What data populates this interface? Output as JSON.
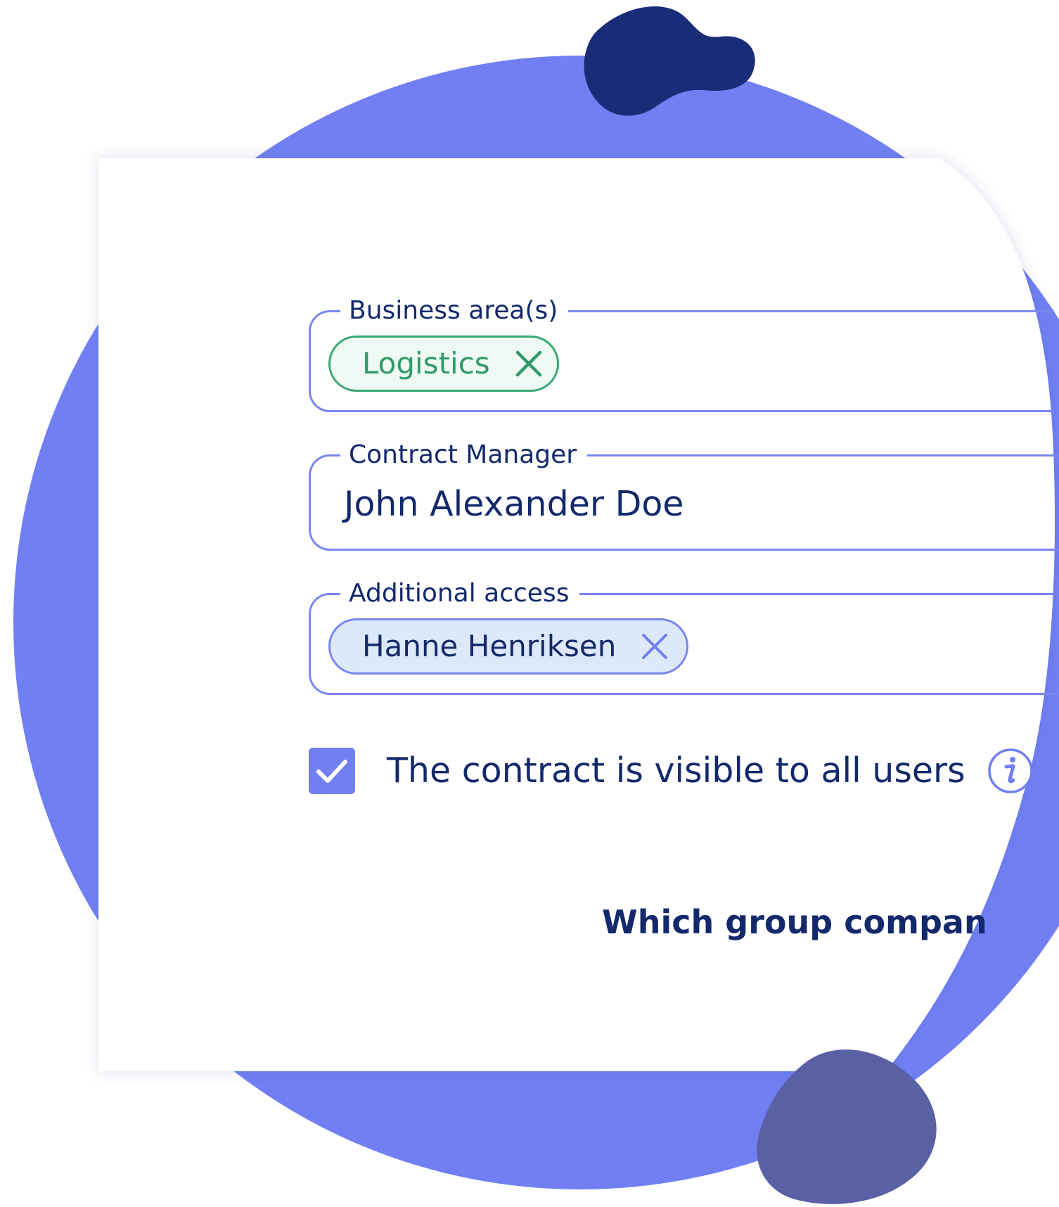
{
  "colors": {
    "accent": "#717ff3",
    "navy": "#13296b",
    "dark_blob": "#1a2b78",
    "slate_blob": "#5a60a4",
    "success": "#3aa776",
    "chip_blue_bg": "#dde8fa"
  },
  "form": {
    "business_area": {
      "label": "Business area(s)",
      "chips": [
        {
          "label": "Logistics",
          "icon": "close-icon"
        }
      ]
    },
    "contract_manager": {
      "label": "Contract Manager",
      "value": "John Alexander Doe"
    },
    "additional_access": {
      "label": "Additional access",
      "chips": [
        {
          "label": "Hanne Henriksen",
          "icon": "close-icon"
        }
      ]
    },
    "visibility": {
      "checked": true,
      "label": "The contract is visible to all users",
      "icon": "info-icon"
    },
    "group_question": "Which group compan"
  }
}
